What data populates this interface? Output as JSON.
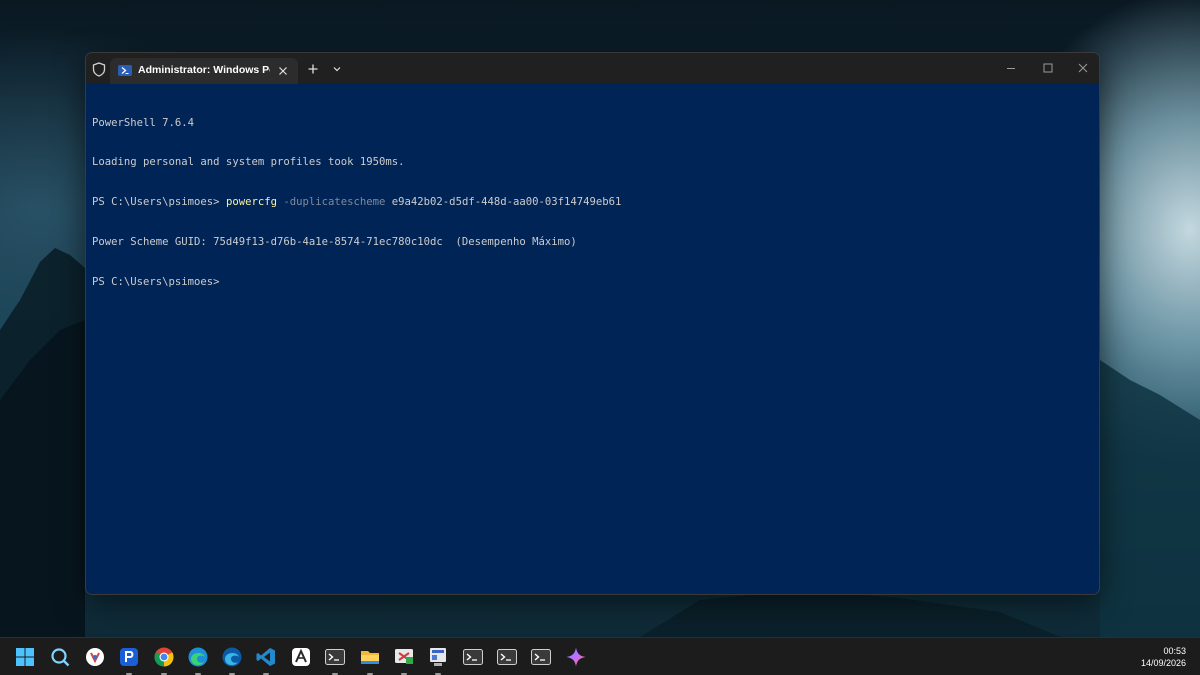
{
  "window": {
    "tab_title": "Administrator: Windows Powe",
    "tab_icon": "powershell-icon",
    "controls": [
      "minimize-icon",
      "maximize-icon",
      "close-icon"
    ]
  },
  "console": {
    "lines": [
      "PowerShell 7.6.4",
      "Loading personal and system profiles took 1950ms.",
      "PS C:\\Users\\psimoes> "
    ],
    "cmd_name": "powercfg",
    "cmd_param": " -duplicatescheme",
    "cmd_arg": " e9a42b02-d5df-448d-aa00-03f14749eb61",
    "output": "Power Scheme GUID: 75d49f13-d76b-4a1e-8574-71ec780c10dc  (Desempenho Máximo)",
    "prompt": "PS C:\\Users\\psimoes>"
  },
  "taskbar": {
    "icons": [
      "start-icon",
      "search-icon",
      "app-icon",
      "app-p-icon",
      "chrome-icon",
      "edge-icon",
      "edge-dev-icon",
      "vscode-icon",
      "app-a-icon",
      "terminal-icon",
      "file-explorer-icon",
      "snipping-icon",
      "app-window-icon",
      "terminal-icon",
      "terminal-icon",
      "terminal-icon",
      "copilot-icon"
    ],
    "time": "00:53",
    "date": "14/09/2026"
  },
  "colors": {
    "console_bg": "#012456",
    "console_text": "#cccccc",
    "command": "#f9f1a5",
    "parameter": "#7f8a9a",
    "titlebar": "#202020",
    "taskbar": "#1c1c1c"
  }
}
